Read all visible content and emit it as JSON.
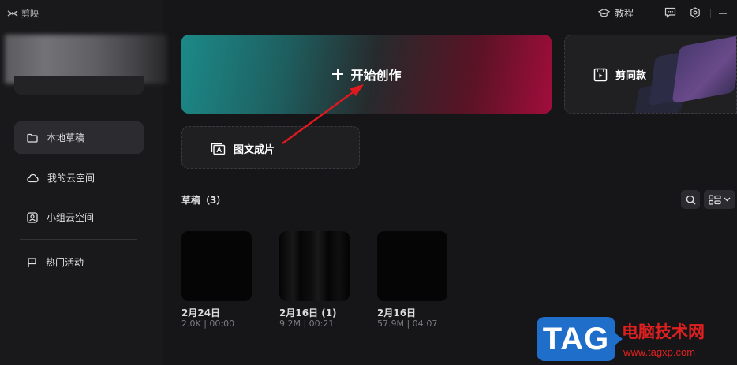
{
  "app": {
    "logo_text": "剪映",
    "logo_icon": "capcut-logo-icon"
  },
  "topbar": {
    "tutorial_label": "教程",
    "tutorial_icon": "graduation-cap-icon",
    "message_icon": "message-icon",
    "settings_icon": "settings-gear-icon",
    "minimize_icon": "minimize-icon"
  },
  "sidebar": {
    "items": [
      {
        "label": "本地草稿",
        "icon": "folder-icon",
        "active": true
      },
      {
        "label": "我的云空间",
        "icon": "cloud-icon",
        "active": false
      },
      {
        "label": "小组云空间",
        "icon": "team-space-icon",
        "active": false
      },
      {
        "label": "热门活动",
        "icon": "flag-icon",
        "active": false
      }
    ]
  },
  "main": {
    "start_label": "开始创作",
    "same_style_label": "剪同款",
    "image_text_label": "图文成片",
    "drafts_title": "草稿（3）"
  },
  "drafts": [
    {
      "name": "2月24日",
      "meta": "2.0K | 00:00"
    },
    {
      "name": "2月16日 (1)",
      "meta": "9.2M | 00:21"
    },
    {
      "name": "2月16日",
      "meta": "57.9M | 04:07"
    }
  ],
  "watermark": {
    "tag": "TAG",
    "title": "电脑技术网",
    "url": "www.tagxp.com"
  },
  "colors": {
    "background": "#161618",
    "sidebar": "#19191b",
    "start_gradient_from": "#1c8a88",
    "start_gradient_to": "#a10d3c",
    "annotation_arrow": "#e0191e",
    "watermark_blue": "#1f6ec9",
    "watermark_red": "#e02020"
  }
}
